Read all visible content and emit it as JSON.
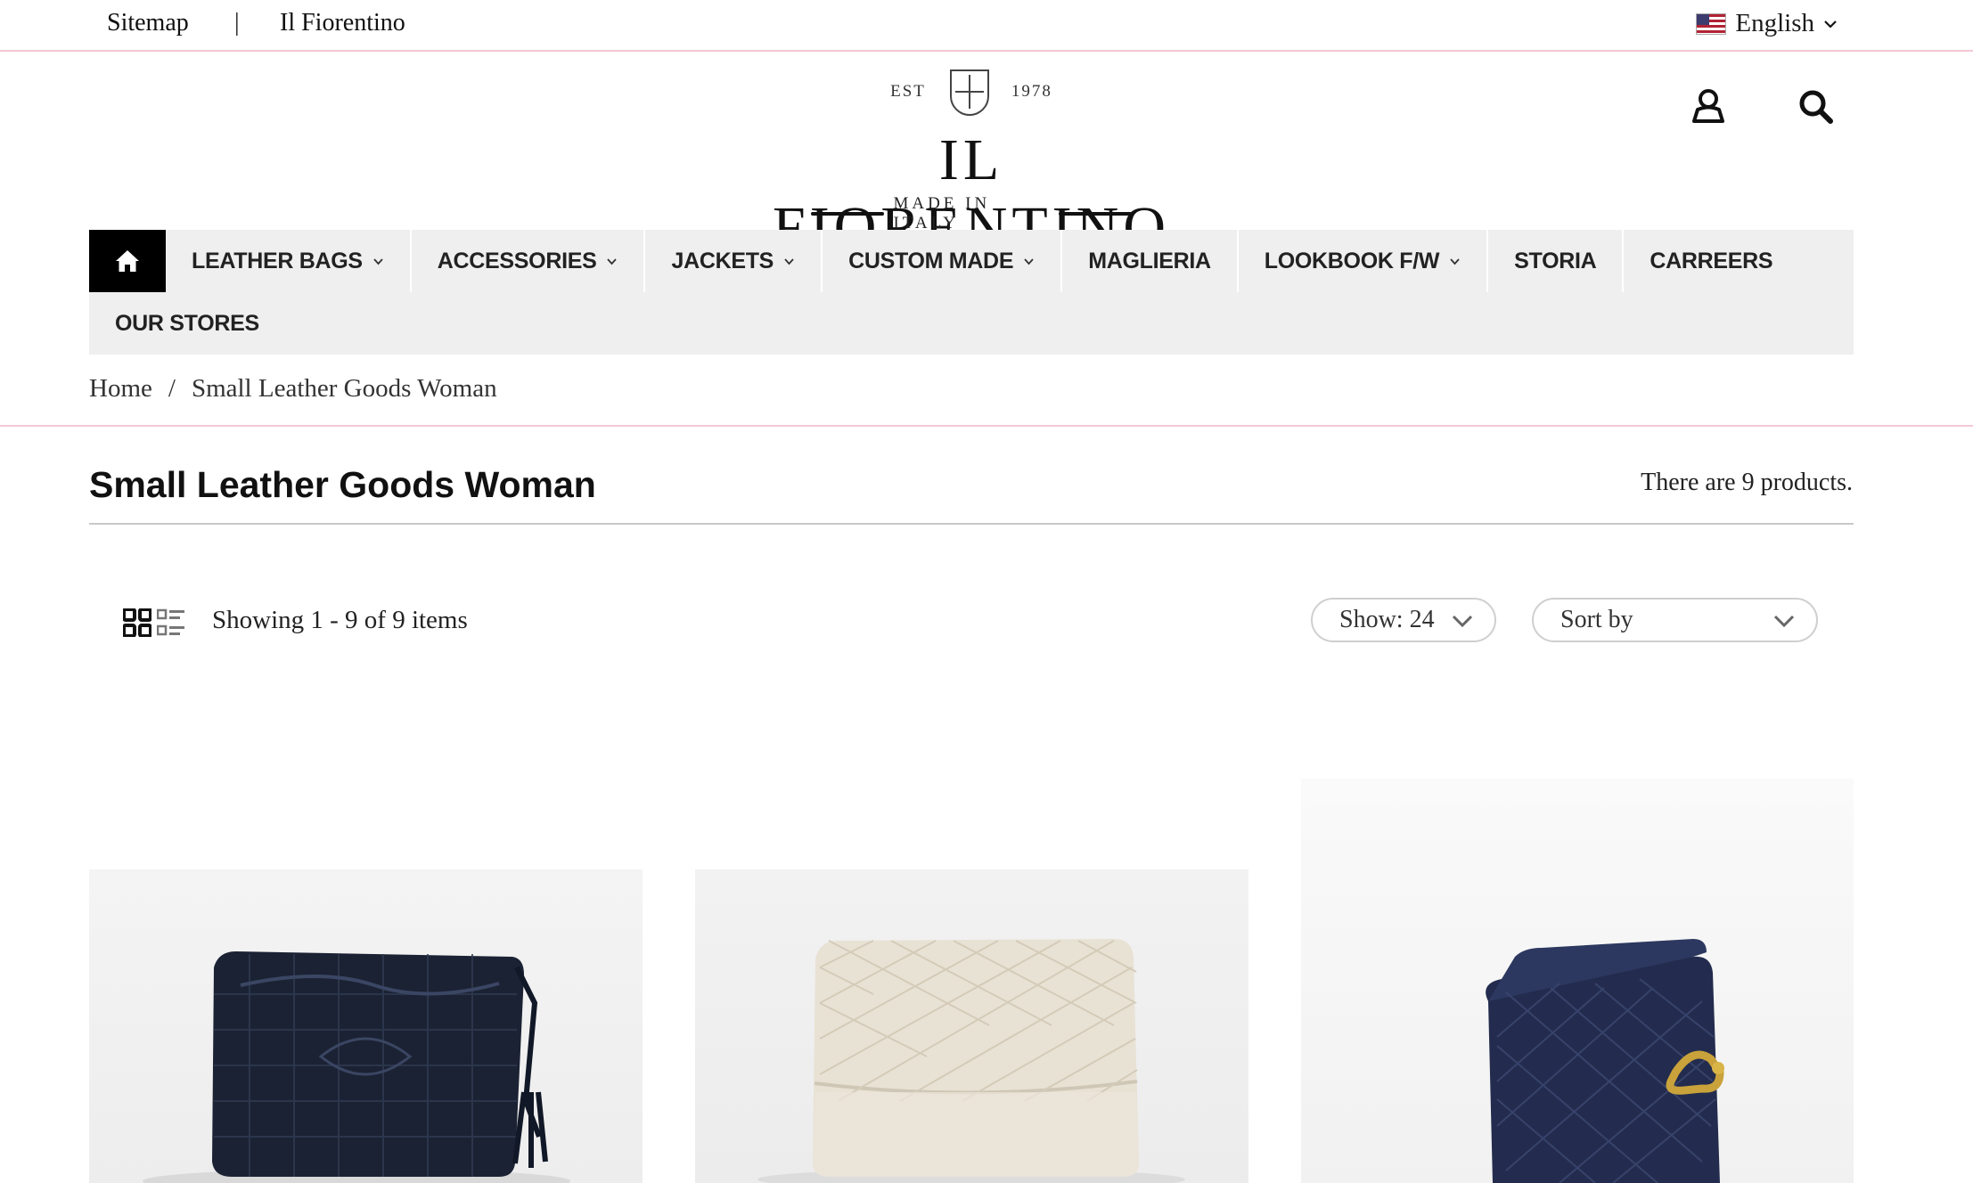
{
  "topbar": {
    "sitemap": "Sitemap",
    "separator": "|",
    "brand_link": "Il Fiorentino",
    "language": "English"
  },
  "logo": {
    "est": "EST",
    "year": "1978",
    "name": "IL FIORENTINO",
    "tagline": "MADE IN ITALY"
  },
  "icons": {
    "account": "user-icon",
    "search": "search-icon",
    "home": "home-icon"
  },
  "nav": {
    "items": [
      {
        "label": "LEATHER BAGS",
        "dropdown": true
      },
      {
        "label": "ACCESSORIES",
        "dropdown": true
      },
      {
        "label": "JACKETS",
        "dropdown": true
      },
      {
        "label": "CUSTOM MADE",
        "dropdown": true
      },
      {
        "label": "MAGLIERIA",
        "dropdown": false
      },
      {
        "label": "LOOKBOOK F/W",
        "dropdown": true
      },
      {
        "label": "STORIA",
        "dropdown": false
      },
      {
        "label": "CARREERS",
        "dropdown": false
      }
    ],
    "second_row": "OUR STORES"
  },
  "breadcrumb": {
    "home": "Home",
    "separator": "/",
    "current": "Small Leather Goods Woman"
  },
  "category": {
    "title": "Small Leather Goods Woman",
    "count_text": "There are 9 products."
  },
  "toolbar": {
    "showing": "Showing 1 - 9 of 9 items",
    "show_select": "Show: 24",
    "sort_select": "Sort by"
  },
  "colors": {
    "accent_rule": "#f3c9d4",
    "nav_bg": "#efefef",
    "home_bg": "#000000"
  }
}
